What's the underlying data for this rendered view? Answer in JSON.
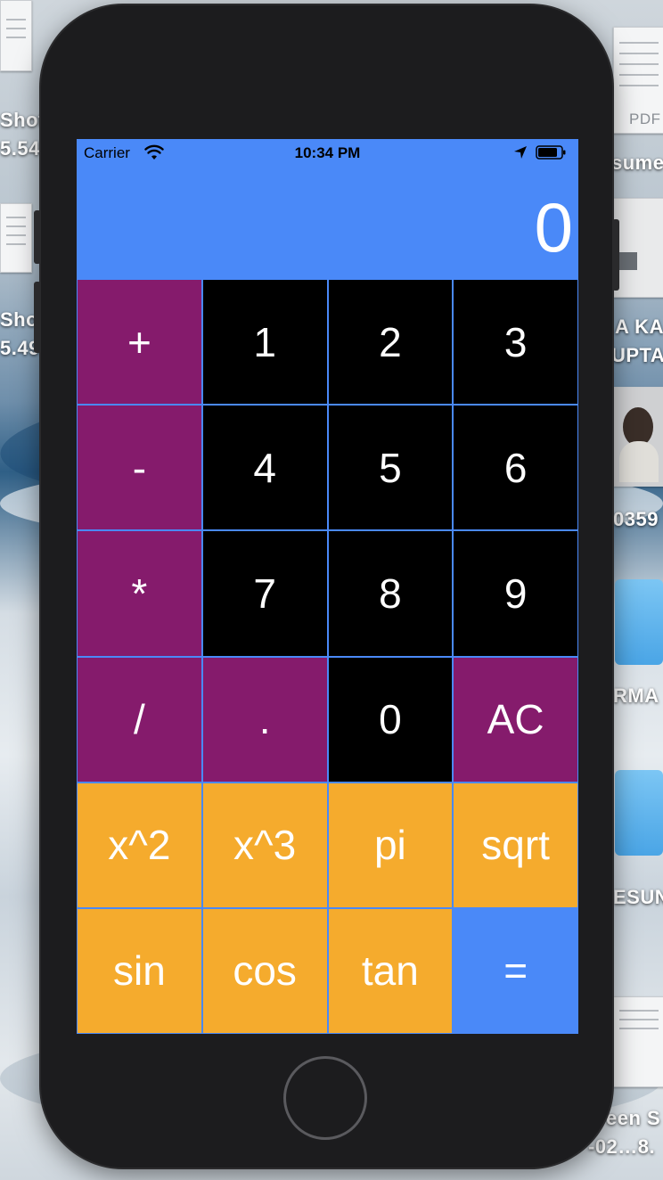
{
  "status_bar": {
    "carrier": "Carrier",
    "time": "10:34 PM"
  },
  "display": {
    "value": "0"
  },
  "keys": [
    {
      "label": "+",
      "kind": "op"
    },
    {
      "label": "1",
      "kind": "num"
    },
    {
      "label": "2",
      "kind": "num"
    },
    {
      "label": "3",
      "kind": "num"
    },
    {
      "label": "-",
      "kind": "op"
    },
    {
      "label": "4",
      "kind": "num"
    },
    {
      "label": "5",
      "kind": "num"
    },
    {
      "label": "6",
      "kind": "num"
    },
    {
      "label": "*",
      "kind": "op"
    },
    {
      "label": "7",
      "kind": "num"
    },
    {
      "label": "8",
      "kind": "num"
    },
    {
      "label": "9",
      "kind": "num"
    },
    {
      "label": "/",
      "kind": "op"
    },
    {
      "label": ".",
      "kind": "op"
    },
    {
      "label": "0",
      "kind": "num"
    },
    {
      "label": "AC",
      "kind": "op"
    },
    {
      "label": "x^2",
      "kind": "fn"
    },
    {
      "label": "x^3",
      "kind": "fn"
    },
    {
      "label": "pi",
      "kind": "fn"
    },
    {
      "label": "sqrt",
      "kind": "fn"
    },
    {
      "label": "sin",
      "kind": "fn"
    },
    {
      "label": "cos",
      "kind": "fn"
    },
    {
      "label": "tan",
      "kind": "fn"
    },
    {
      "label": "=",
      "kind": "eq"
    }
  ],
  "colors": {
    "screen_background": "#4a89f8",
    "operator_key": "#851b6c",
    "number_key": "#000000",
    "function_key": "#f5ab2d",
    "equals_key": "#4a89f8"
  },
  "desktop": {
    "labels_left": [
      "Shot",
      "5.54",
      "Sho",
      "5.49"
    ],
    "labels_right": [
      "PDF",
      "sume",
      "A KA",
      "UPTA.",
      "0359",
      "RMA",
      "ESUN",
      "een S",
      "-02…8."
    ]
  }
}
